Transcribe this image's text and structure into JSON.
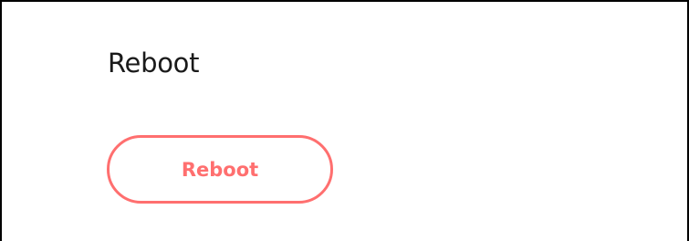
{
  "section": {
    "title": "Reboot"
  },
  "actions": {
    "reboot_label": "Reboot"
  },
  "colors": {
    "accent": "#ff6f6f",
    "text": "#1a1a1a",
    "border": "#000000",
    "background": "#ffffff"
  }
}
